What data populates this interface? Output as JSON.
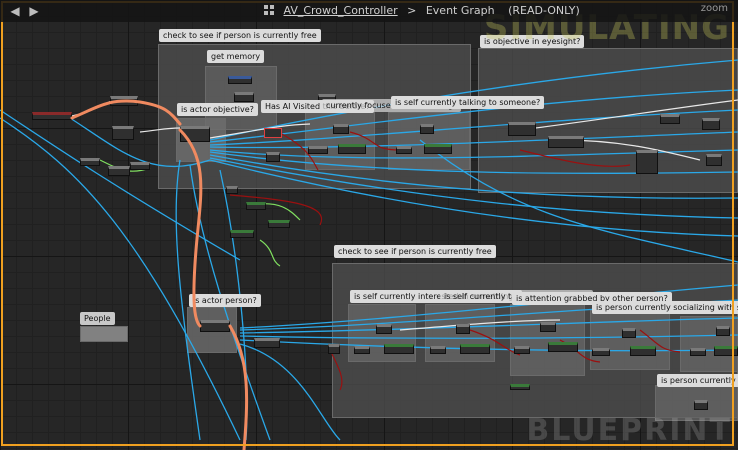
{
  "titlebar": {
    "back_label": "◀",
    "forward_label": "▶",
    "blueprint_name": "AV_Crowd_Controller",
    "separator": ">",
    "graph_name": "Event Graph",
    "mode": "(READ-ONLY)",
    "zoom": "zoom"
  },
  "watermarks": {
    "simulating": "SIMULATING",
    "blueprint": "BLUEPRINT"
  },
  "comments": {
    "check_free_top": "check to see if person is currently free",
    "get_memory": "get memory",
    "is_actor_objective": "is actor objective?",
    "has_ai_visited": "Has AI Visited this before?",
    "currently_focused": "currently focused on something?",
    "talking_top": "is self currently talking to someone?",
    "objective_eyesight": "is objective in eyesight?",
    "check_free_bottom": "check to see if person is currently free",
    "is_actor_person": "is actor person?",
    "self_interested": "is self currently interested in something?",
    "self_talking_bottom": "is self currently talking to someone?",
    "attention_grabbed": "is attention grabbed by other person?",
    "socializing": "is person currently socializing with someone",
    "currently_look": "is person currently look",
    "people": "People"
  },
  "colors": {
    "exec_wire": "#e8e8e8",
    "object_wire": "#2aa8e8",
    "struct_wire": "#f08a60",
    "bool_wire": "#9a1010",
    "float_wire": "#80e060",
    "frame": "#f0a020"
  }
}
